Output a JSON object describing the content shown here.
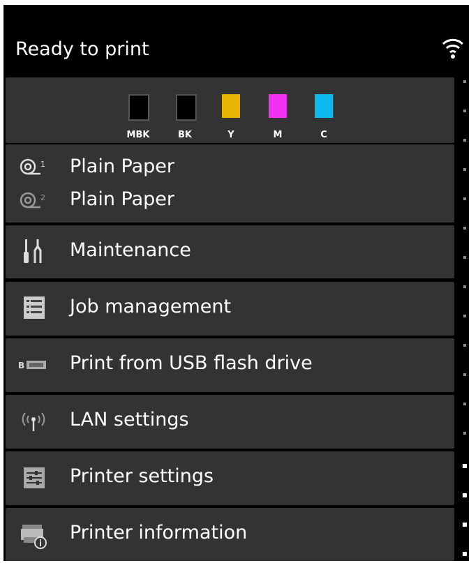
{
  "status": {
    "text": "Ready to print",
    "icon": "wifi-icon"
  },
  "inks": [
    {
      "label": "MBK",
      "color": "#000000"
    },
    {
      "label": "BK",
      "color": "#000000"
    },
    {
      "label": "Y",
      "color": "#e8b400"
    },
    {
      "label": "M",
      "color": "#f030f0"
    },
    {
      "label": "C",
      "color": "#10b8f0"
    }
  ],
  "paper": {
    "roll1": {
      "label": "Plain Paper",
      "icon": "roll-1-icon"
    },
    "roll2": {
      "label": "Plain Paper",
      "icon": "roll-2-icon"
    }
  },
  "menu": {
    "maintenance": {
      "label": "Maintenance",
      "icon": "maintenance-icon"
    },
    "job_management": {
      "label": "Job management",
      "icon": "job-list-icon"
    },
    "usb": {
      "label": "Print from USB flash drive",
      "icon": "usb-drive-icon"
    },
    "lan": {
      "label": "LAN settings",
      "icon": "antenna-icon"
    },
    "printer_settings": {
      "label": "Printer settings",
      "icon": "sliders-icon"
    },
    "printer_info": {
      "label": "Printer information",
      "icon": "printer-info-icon"
    }
  },
  "colors": {
    "background": "#000000",
    "item_bg": "#333333",
    "text": "#ffffff"
  }
}
